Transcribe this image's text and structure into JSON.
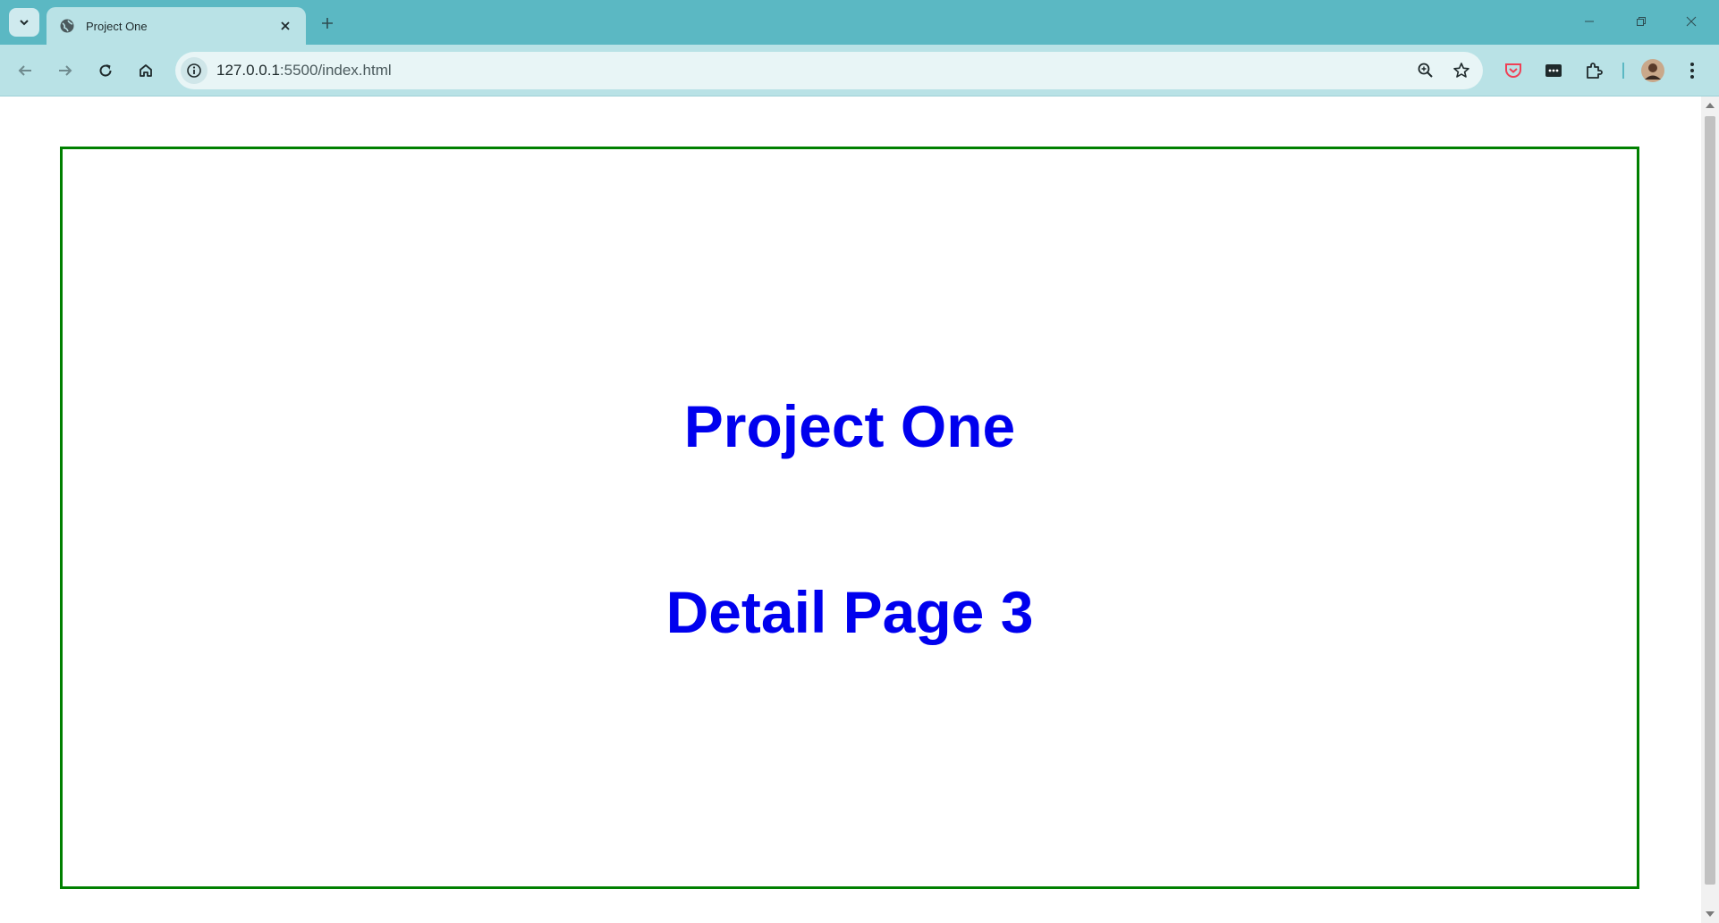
{
  "browser": {
    "tab": {
      "title": "Project One"
    },
    "address": {
      "host": "127.0.0.1",
      "rest": ":5500/index.html"
    }
  },
  "page": {
    "title": "Project One",
    "subtitle": "Detail Page 3"
  },
  "colors": {
    "frame": "#5bb8c3",
    "toolbar": "#b9e2e6",
    "heading": "#0000ee",
    "border": "#008000"
  },
  "icons": [
    "tab-search-icon",
    "globe-icon",
    "close-icon",
    "plus-icon",
    "minimize-icon",
    "restore-icon",
    "window-close-icon",
    "back-icon",
    "forward-icon",
    "reload-icon",
    "home-icon",
    "info-icon",
    "zoom-icon",
    "star-icon",
    "pocket-icon",
    "password-icon",
    "extensions-icon",
    "avatar",
    "menu-icon"
  ]
}
